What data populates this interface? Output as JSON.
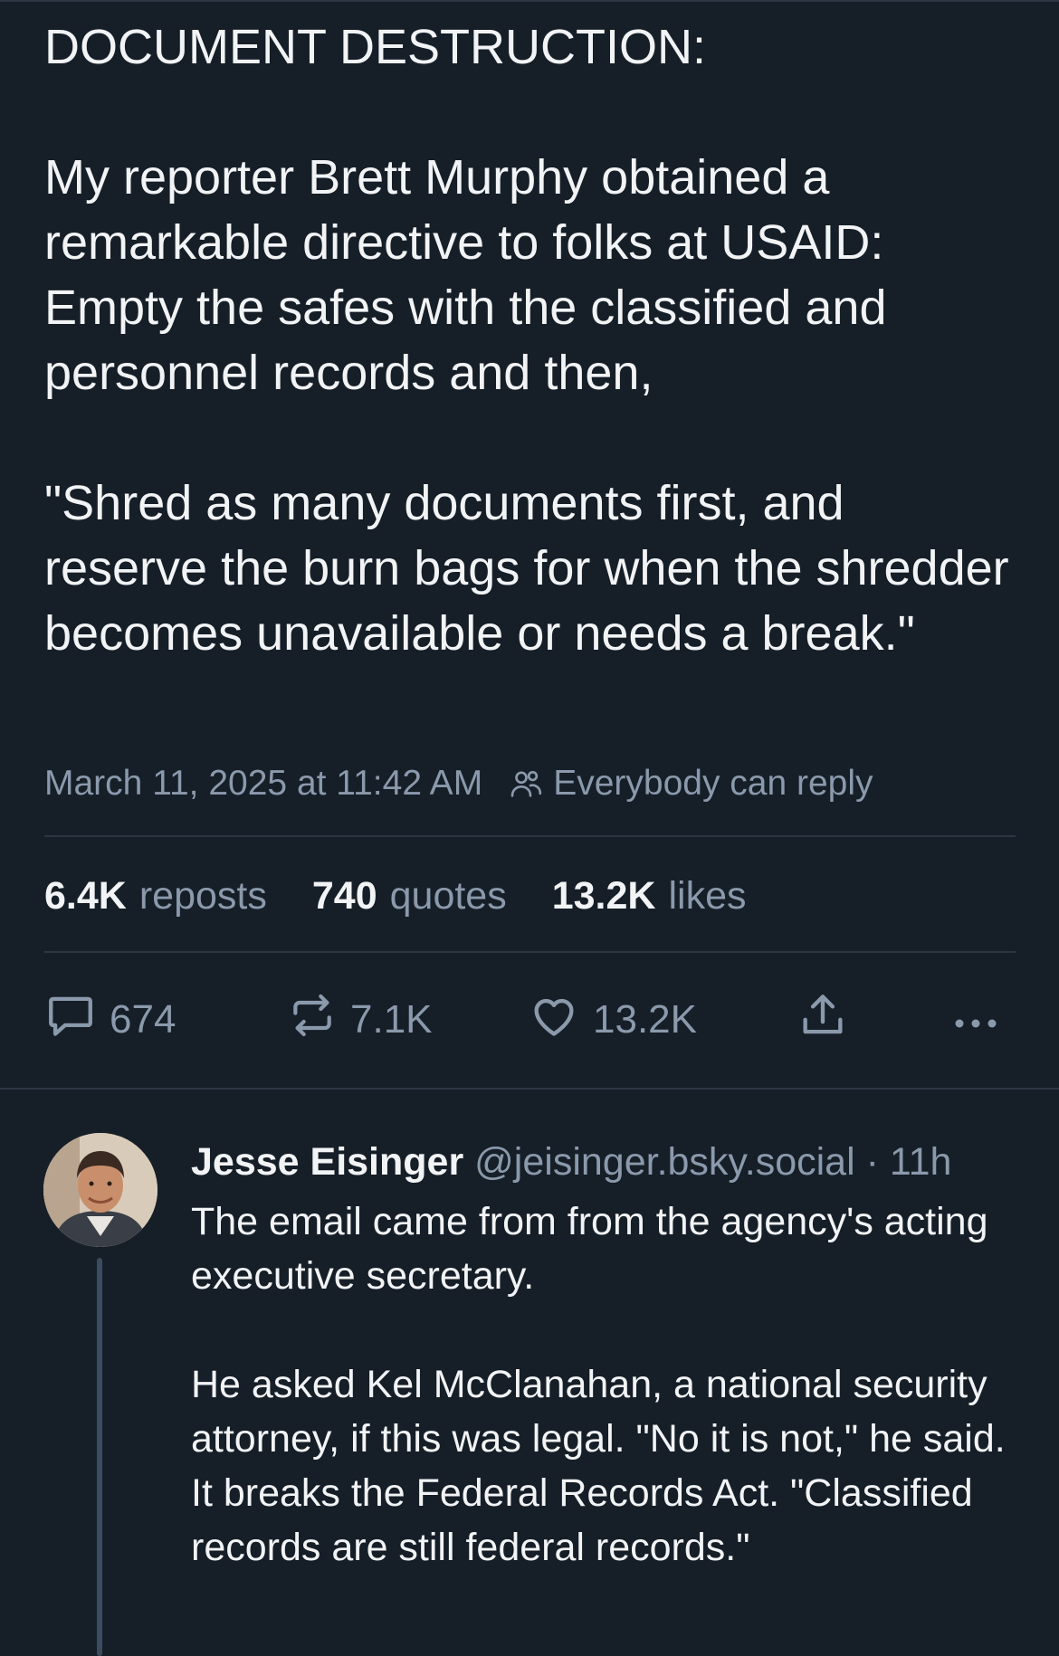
{
  "post": {
    "text": "DOCUMENT DESTRUCTION:\n\nMy reporter Brett Murphy obtained a remarkable directive to folks at USAID: Empty the safes with the classified and personnel records and then,\n\n\"Shred as many documents first, and reserve the burn bags for when the shredder becomes unavailable or needs a break.\"",
    "timestamp": "March 11, 2025 at 11:42 AM",
    "reply_setting": "Everybody can reply",
    "reply_setting_icon": "people-icon"
  },
  "stats": {
    "reposts_count": "6.4K",
    "reposts_label": "reposts",
    "quotes_count": "740",
    "quotes_label": "quotes",
    "likes_count": "13.2K",
    "likes_label": "likes"
  },
  "actions": {
    "reply_count": "674",
    "repost_count": "7.1K",
    "like_count": "13.2K",
    "icons": [
      "comment-icon",
      "repost-icon",
      "heart-icon",
      "share-icon",
      "more-icon"
    ]
  },
  "reply": {
    "author_name": "Jesse Eisinger",
    "author_handle": "@jeisinger.bsky.social",
    "time": "11h",
    "separator": " · ",
    "text": "The email came from from the agency's acting executive secretary.\n\nHe asked Kel McClanahan, a national security attorney, if this was legal. \"No it is not,\" he said. It breaks the Federal Records Act. \"Classified records are still federal records.\""
  },
  "colors": {
    "background": "#161e27",
    "text": "#f1f3f5",
    "muted": "#8a99ab",
    "divider": "#2c3643"
  }
}
